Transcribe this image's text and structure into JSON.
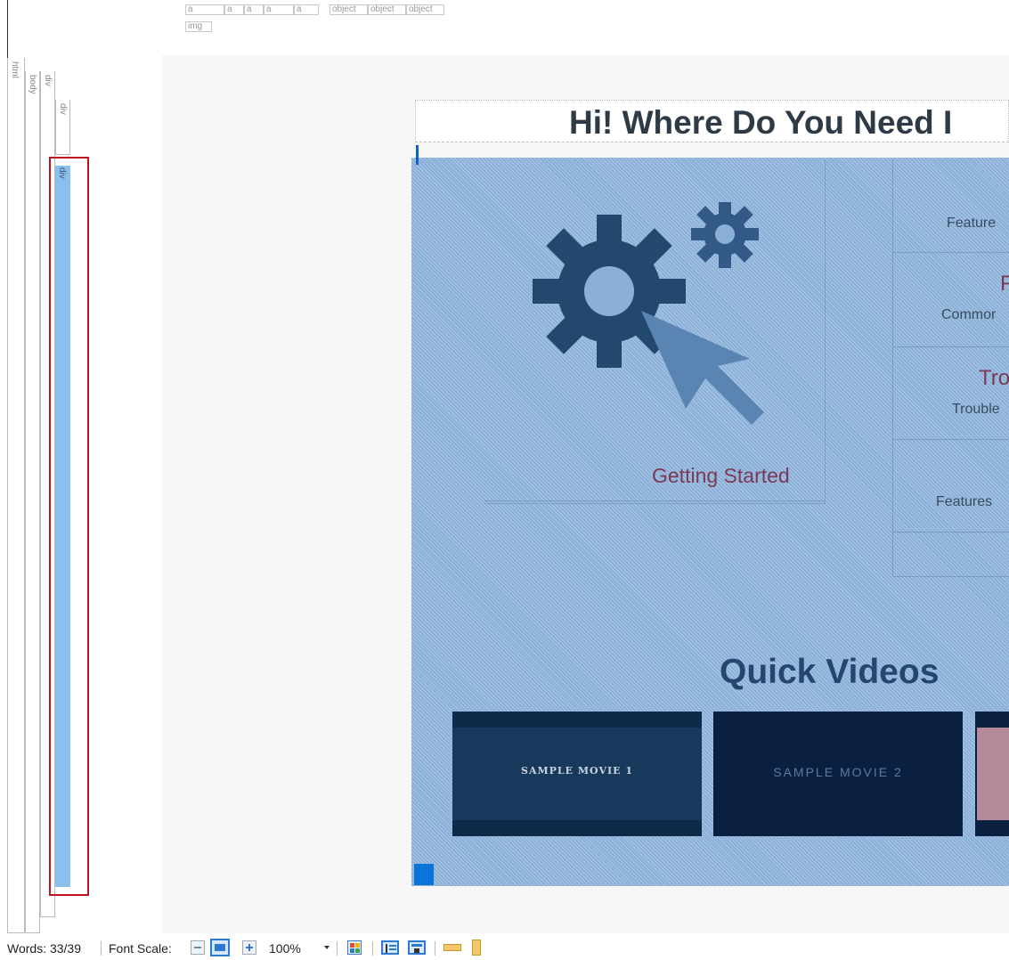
{
  "top_tags": {
    "row1": [
      "a",
      "a",
      "a",
      "a",
      "a"
    ],
    "objects": [
      "object",
      "object",
      "object"
    ],
    "row2": [
      "img"
    ]
  },
  "tag_tree": {
    "html": "html",
    "body": "body",
    "div1": "div",
    "div2": "div",
    "div_selected": "div"
  },
  "page": {
    "heading": "Hi! Where Do You Need I",
    "getting_started": "Getting Started",
    "right_col": {
      "item1": "Feature",
      "item2_title": "F",
      "item2_sub": "Commor",
      "item3_title": "Tro",
      "item3_sub": "Trouble",
      "item4": "Features"
    },
    "quick_videos": "Quick Videos",
    "thumbs": [
      "SAMPLE MOVIE 1",
      "SAMPLE MOVIE 2"
    ]
  },
  "status": {
    "words": "Words: 33/39",
    "font_scale_label": "Font Scale:",
    "zoom": "100%"
  },
  "colors": {
    "selection_overlay": "#8ab0d8",
    "selection_border": "#c01520",
    "heading": "#2e3a46",
    "link": "#7a3a55"
  }
}
